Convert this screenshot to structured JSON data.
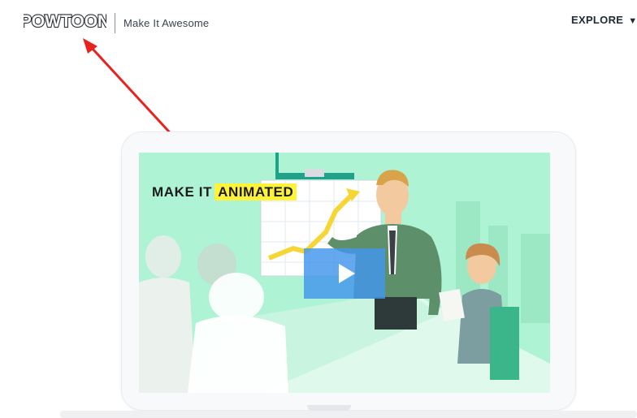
{
  "brand": {
    "logo_text": "POWTOON",
    "tagline": "Make It Awesome"
  },
  "nav": {
    "explore_label": "EXPLORE",
    "explore_icon": "triangle-down-icon"
  },
  "video": {
    "headline_prefix": "MAKE IT",
    "headline_highlight": "ANIMATED",
    "play_icon": "play-icon"
  },
  "colors": {
    "annotation_arrow": "#e8221e",
    "video_background": "#aef3d3",
    "highlight": "#fff23a",
    "play_button": "#4296ec"
  }
}
